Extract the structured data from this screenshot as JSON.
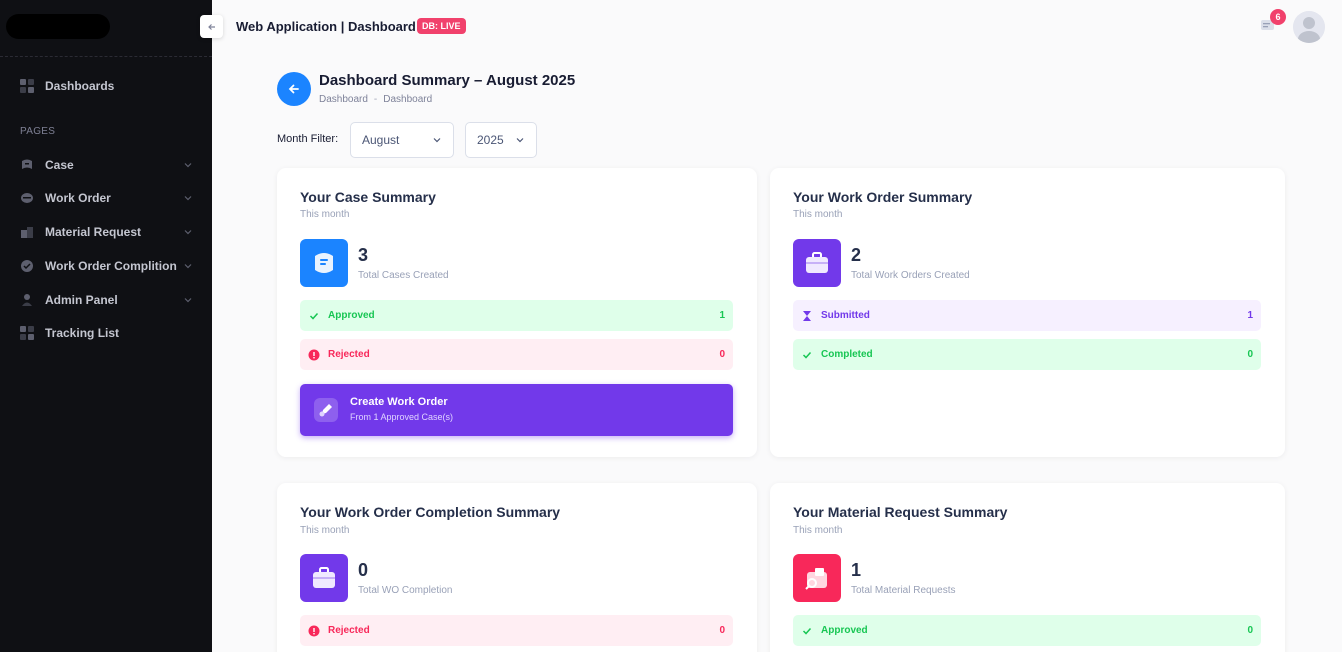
{
  "header": {
    "title": "Web Application | Dashboard",
    "db_badge": "DB: LIVE",
    "notification_count": "6"
  },
  "sidebar": {
    "section_label": "PAGES",
    "items": [
      {
        "label": "Dashboards",
        "icon": "grid-icon"
      },
      {
        "label": "Case",
        "icon": "case-icon"
      },
      {
        "label": "Work Order",
        "icon": "work-order-icon"
      },
      {
        "label": "Material Request",
        "icon": "material-icon"
      },
      {
        "label": "Work Order Complition",
        "icon": "completion-icon"
      },
      {
        "label": "Admin Panel",
        "icon": "user-icon"
      },
      {
        "label": "Tracking List",
        "icon": "grid-icon"
      }
    ]
  },
  "page": {
    "title": "Dashboard Summary – August 2025",
    "breadcrumb": [
      "Dashboard",
      "Dashboard"
    ],
    "filter_label": "Month Filter:",
    "month": "August",
    "year": "2025"
  },
  "cards": {
    "case": {
      "title": "Your Case Summary",
      "subtitle": "This month",
      "count": "3",
      "count_label": "Total Cases Created",
      "rows": [
        {
          "label": "Approved",
          "value": "1"
        },
        {
          "label": "Rejected",
          "value": "0"
        }
      ],
      "cta_title": "Create Work Order",
      "cta_sub": "From 1 Approved Case(s)"
    },
    "work_order": {
      "title": "Your Work Order Summary",
      "subtitle": "This month",
      "count": "2",
      "count_label": "Total Work Orders Created",
      "rows": [
        {
          "label": "Submitted",
          "value": "1"
        },
        {
          "label": "Completed",
          "value": "0"
        }
      ]
    },
    "completion": {
      "title": "Your Work Order Completion Summary",
      "subtitle": "This month",
      "count": "0",
      "count_label": "Total WO Completion",
      "rows": [
        {
          "label": "Rejected",
          "value": "0"
        }
      ]
    },
    "material": {
      "title": "Your Material Request Summary",
      "subtitle": "This month",
      "count": "1",
      "count_label": "Total Material Requests",
      "rows": [
        {
          "label": "Approved",
          "value": "0"
        }
      ]
    }
  },
  "colors": {
    "sidebar_bg": "#0f1014",
    "primary": "#1b84ff",
    "purple": "#7239ea",
    "danger": "#f1416c",
    "success": "#17c653"
  }
}
